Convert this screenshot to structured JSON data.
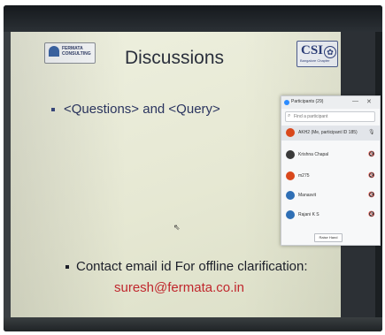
{
  "slide": {
    "title": "Discussions",
    "logo_left": {
      "text": "FERMATA CONSULTING",
      "icon": "fermata-logo"
    },
    "logo_right": {
      "text": "CSI",
      "sub": "Bangalore Chapter",
      "icon": "csi-seal-icon"
    },
    "bullet1": "<Questions> and <Query>",
    "bullet2": "Contact email id For offline clarification:",
    "email": "suresh@fermata.co.in"
  },
  "participants": {
    "title": "Participants (29)",
    "search_placeholder": "Find a participant",
    "items": [
      {
        "name": "AKH2 (Me, participant ID 185)",
        "avatar_color": "#d9481c"
      },
      {
        "name": "Krishna Chapal",
        "avatar_color": "#3a3a3a"
      },
      {
        "name": "m275",
        "avatar_color": "#d9481c"
      },
      {
        "name": "Manasvit",
        "avatar_color": "#2f6fb5"
      },
      {
        "name": "Rajani K S",
        "avatar_color": "#2f6fb5"
      }
    ],
    "footer_button": "Raise Hand"
  },
  "colors": {
    "email": "#c0272d",
    "slide_background": "#e9ebd8",
    "panel_accent": "#2d8cff"
  }
}
